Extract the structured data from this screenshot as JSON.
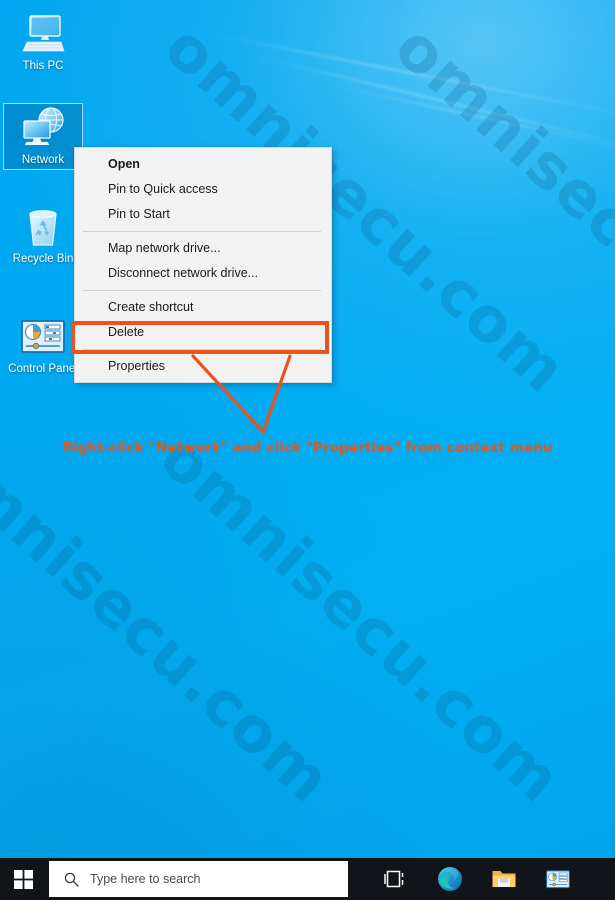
{
  "desktop": {
    "wallpaper_color": "#00a6f0",
    "icons": [
      {
        "id": "this-pc",
        "label": "This PC",
        "icon": "computer-monitor-icon",
        "selected": false
      },
      {
        "id": "network",
        "label": "Network",
        "icon": "network-globe-icon",
        "selected": true
      },
      {
        "id": "recycle-bin",
        "label": "Recycle Bin",
        "icon": "recycle-bin-icon",
        "selected": false
      },
      {
        "id": "control-panel",
        "label": "Control Panel",
        "icon": "control-panel-icon",
        "selected": false
      }
    ],
    "watermark": "omnisecu.com"
  },
  "context_menu": {
    "items": [
      {
        "label": "Open",
        "bold": true,
        "separator_after": false
      },
      {
        "label": "Pin to Quick access",
        "bold": false,
        "separator_after": false
      },
      {
        "label": "Pin to Start",
        "bold": false,
        "separator_after": true
      },
      {
        "label": "Map network drive...",
        "bold": false,
        "separator_after": false
      },
      {
        "label": "Disconnect network drive...",
        "bold": false,
        "separator_after": true
      },
      {
        "label": "Create shortcut",
        "bold": false,
        "separator_after": false
      },
      {
        "label": "Delete",
        "bold": false,
        "separator_after": true
      },
      {
        "label": "Properties",
        "bold": false,
        "separator_after": false
      }
    ]
  },
  "annotation": {
    "text": "Right-click \"Network\" and click \"Properties\" from context menu",
    "color": "#e8541c",
    "highlighted_item": "Properties"
  },
  "taskbar": {
    "start_label": "Start",
    "search": {
      "placeholder": "Type here to search",
      "icon": "search-icon"
    },
    "icons": [
      {
        "id": "task-view",
        "name": "task-view-icon",
        "label": "Task View"
      },
      {
        "id": "microsoft-edge",
        "name": "microsoft-edge-icon",
        "label": "Microsoft Edge"
      },
      {
        "id": "file-explorer",
        "name": "file-explorer-icon",
        "label": "File Explorer"
      },
      {
        "id": "control-panel",
        "name": "control-panel-icon",
        "label": "Control Panel"
      }
    ]
  }
}
